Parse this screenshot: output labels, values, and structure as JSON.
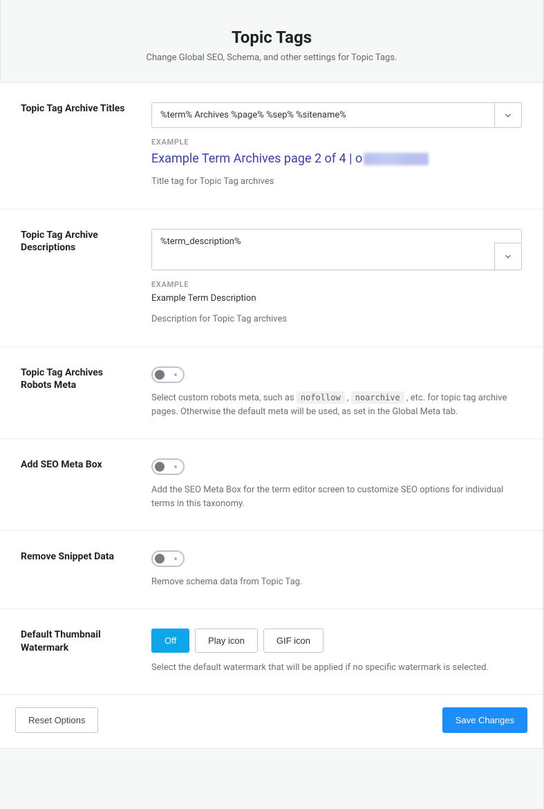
{
  "header": {
    "title": "Topic Tags",
    "subtitle": "Change Global SEO, Schema, and other settings for Topic Tags."
  },
  "sections": {
    "titles": {
      "label": "Topic Tag Archive Titles",
      "value": "%term% Archives %page% %sep% %sitename%",
      "example_label": "EXAMPLE",
      "preview_prefix": "Example Term Archives page 2 of 4 | o",
      "helptext": "Title tag for Topic Tag archives"
    },
    "descriptions": {
      "label": "Topic Tag Archive Descriptions",
      "value": "%term_description%",
      "example_label": "EXAMPLE",
      "preview": "Example Term Description",
      "helptext": "Description for Topic Tag archives"
    },
    "robots": {
      "label": "Topic Tag Archives Robots Meta",
      "help_prefix": "Select custom robots meta, such as ",
      "code1": "nofollow",
      "help_mid": " , ",
      "code2": "noarchive",
      "help_suffix": " , etc. for topic tag archive pages. Otherwise the default meta will be used, as set in the Global Meta tab.",
      "enabled": false
    },
    "metabox": {
      "label": "Add SEO Meta Box",
      "helptext": "Add the SEO Meta Box for the term editor screen to customize SEO options for individual terms in this taxonomy.",
      "enabled": false
    },
    "snippet": {
      "label": "Remove Snippet Data",
      "helptext": "Remove schema data from Topic Tag.",
      "enabled": false
    },
    "watermark": {
      "label": "Default Thumbnail Watermark",
      "options": {
        "off": "Off",
        "play": "Play icon",
        "gif": "GIF icon"
      },
      "selected": "off",
      "helptext": "Select the default watermark that will be applied if no specific watermark is selected."
    }
  },
  "footer": {
    "reset": "Reset Options",
    "save": "Save Changes"
  }
}
